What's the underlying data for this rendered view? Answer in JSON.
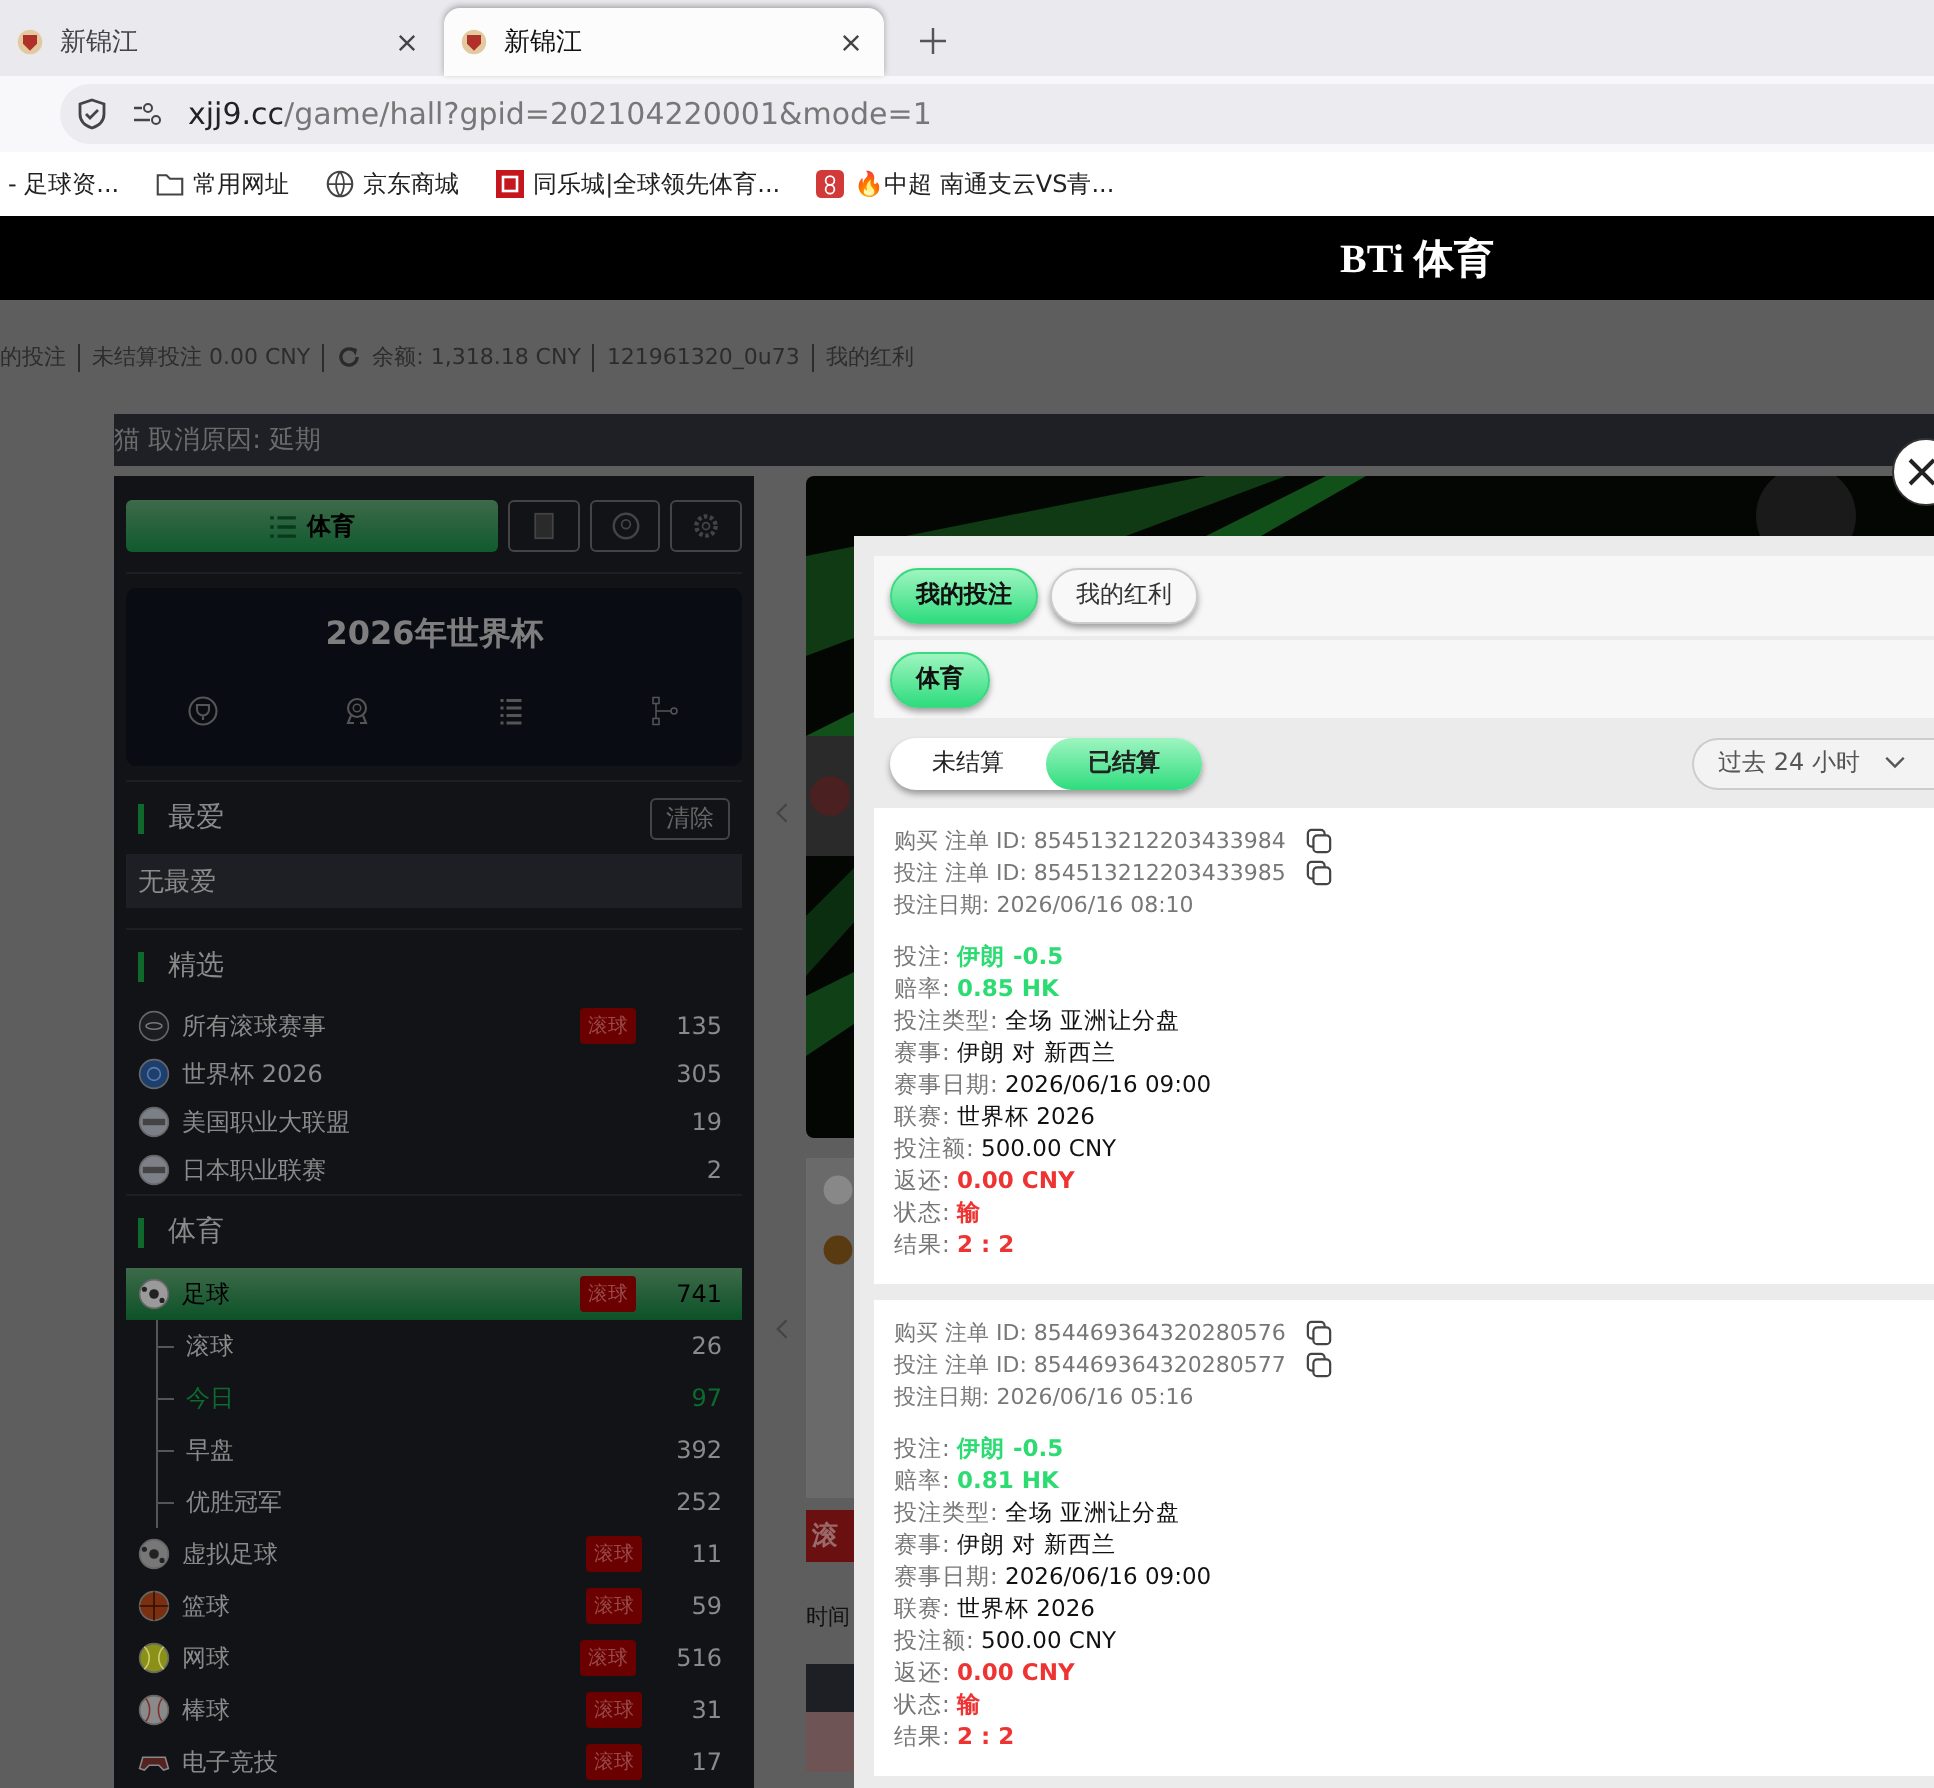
{
  "browser": {
    "tabs": [
      {
        "title": "新锦江",
        "selected": false
      },
      {
        "title": "新锦江",
        "selected": true
      }
    ],
    "url_host": "xjj9.cc",
    "url_path": "/game/hall?gpid=202104220001&mode=1",
    "bookmarks": [
      {
        "label": "- 足球资...",
        "kind": "none"
      },
      {
        "label": "常用网址",
        "kind": "folder"
      },
      {
        "label": "京东商城",
        "kind": "globe"
      },
      {
        "label": "同乐城|全球领先体育...",
        "kind": "square"
      },
      {
        "label": "🔥中超 南通支云VS青...",
        "kind": "app"
      }
    ]
  },
  "header": {
    "title": "BTi 体育"
  },
  "info_bar": [
    {
      "text": "的投注",
      "refresh": false
    },
    {
      "text": "未结算投注 0.00 CNY",
      "refresh": false
    },
    {
      "text": "余额: 1,318.18 CNY",
      "refresh": true
    },
    {
      "text": "121961320_0u73",
      "refresh": false
    },
    {
      "text": "我的红利",
      "refresh": false
    }
  ],
  "notice": "猫 取消原因: 延期",
  "sidebar": {
    "main_tab": {
      "label": "体育",
      "selected": true
    },
    "world_cup": {
      "title": "2026年世界杯"
    },
    "favorites": {
      "title": "最爱",
      "clear": "清除",
      "empty": "无最爱"
    },
    "featured": {
      "title": "精选",
      "items": [
        {
          "name": "所有滚球赛事",
          "live": "滚球",
          "count": "135"
        },
        {
          "name": "世界杯 2026",
          "count": "305"
        },
        {
          "name": "美国职业大联盟",
          "count": "19"
        },
        {
          "name": "日本职业联赛",
          "count": "2"
        }
      ]
    },
    "sports": {
      "title": "体育",
      "items": [
        {
          "name": "足球",
          "live": "滚球",
          "count": "741",
          "selected": true,
          "children": [
            {
              "name": "滚球",
              "count": "26",
              "selected": false
            },
            {
              "name": "今日",
              "count": "97",
              "selected": true
            },
            {
              "name": "早盘",
              "count": "392",
              "selected": false
            },
            {
              "name": "优胜冠军",
              "count": "252",
              "selected": false
            }
          ]
        },
        {
          "name": "虚拟足球",
          "live": "滚球",
          "count": "11",
          "selected": false
        },
        {
          "name": "篮球",
          "live": "滚球",
          "count": "59",
          "selected": false
        },
        {
          "name": "网球",
          "live": "滚球",
          "count": "516",
          "selected": false
        },
        {
          "name": "棒球",
          "live": "滚球",
          "count": "31",
          "selected": false
        },
        {
          "name": "电子竞技",
          "live": "滚球",
          "count": "17",
          "selected": false
        }
      ]
    }
  },
  "middle": {
    "live_button": "滚",
    "time_label": "时间"
  },
  "modal": {
    "tabs": [
      {
        "label": "我的投注",
        "selected": true
      },
      {
        "label": "我的红利",
        "selected": false
      }
    ],
    "categories": [
      {
        "label": "体育",
        "selected": true
      }
    ],
    "status_tabs": [
      {
        "label": "未结算",
        "selected": false
      },
      {
        "label": "已结算",
        "selected": true
      }
    ],
    "period": "过去 24 小时",
    "bets": [
      {
        "ids": [
          {
            "label": "购买 注单 ID:",
            "value": "854513212203433984"
          },
          {
            "label": "投注 注单 ID:",
            "value": "854513212203433985"
          }
        ],
        "date": {
          "label": "投注日期:",
          "value": "2026/06/16 08:10"
        },
        "details": [
          {
            "label": "投注:",
            "value": "伊朗 -0.5",
            "kind": "green"
          },
          {
            "label": "赔率:",
            "value": "0.85 HK",
            "kind": "green"
          },
          {
            "label": "投注类型:",
            "value": "全场 亚洲让分盘",
            "kind": "plain"
          },
          {
            "label": "赛事:",
            "value": "伊朗 对 新西兰",
            "kind": "plain"
          },
          {
            "label": "赛事日期:",
            "value": "2026/06/16 09:00",
            "kind": "plain"
          },
          {
            "label": "联赛:",
            "value": "世界杯 2026",
            "kind": "plain"
          },
          {
            "label": "投注额:",
            "value": "500.00 CNY",
            "kind": "plain"
          },
          {
            "label": "返还:",
            "value": "0.00 CNY",
            "kind": "red"
          },
          {
            "label": "状态:",
            "value": "输",
            "kind": "red"
          },
          {
            "label": "结果:",
            "value": "2 : 2",
            "kind": "red"
          }
        ]
      },
      {
        "ids": [
          {
            "label": "购买 注单 ID:",
            "value": "854469364320280576"
          },
          {
            "label": "投注 注单 ID:",
            "value": "854469364320280577"
          }
        ],
        "date": {
          "label": "投注日期:",
          "value": "2026/06/16 05:16"
        },
        "details": [
          {
            "label": "投注:",
            "value": "伊朗 -0.5",
            "kind": "green"
          },
          {
            "label": "赔率:",
            "value": "0.81 HK",
            "kind": "green"
          },
          {
            "label": "投注类型:",
            "value": "全场 亚洲让分盘",
            "kind": "plain"
          },
          {
            "label": "赛事:",
            "value": "伊朗 对 新西兰",
            "kind": "plain"
          },
          {
            "label": "赛事日期:",
            "value": "2026/06/16 09:00",
            "kind": "plain"
          },
          {
            "label": "联赛:",
            "value": "世界杯 2026",
            "kind": "plain"
          },
          {
            "label": "投注额:",
            "value": "500.00 CNY",
            "kind": "plain"
          },
          {
            "label": "返还:",
            "value": "0.00 CNY",
            "kind": "red"
          },
          {
            "label": "状态:",
            "value": "输",
            "kind": "red"
          },
          {
            "label": "结果:",
            "value": "2 : 2",
            "kind": "red"
          }
        ]
      }
    ]
  }
}
